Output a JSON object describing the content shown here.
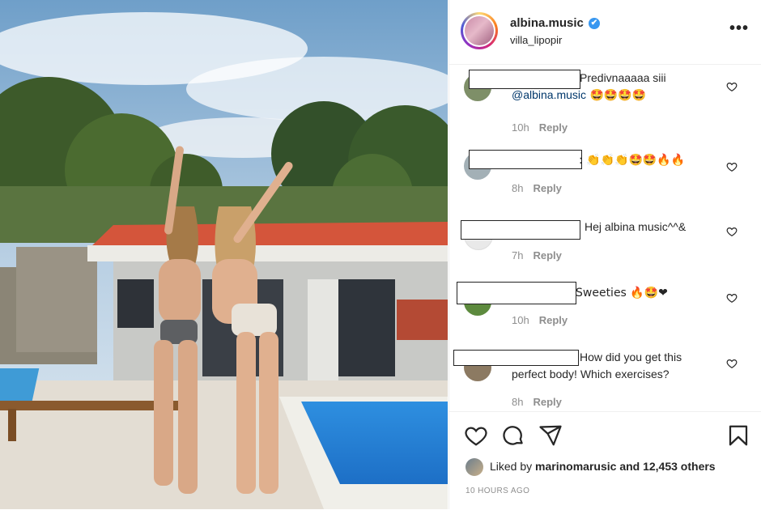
{
  "post": {
    "username": "albina.music",
    "verified_mark": "✔",
    "location": "villa_lipopir",
    "more_label": "•••",
    "likes_prefix": "Liked by",
    "likes_user": "marinomarusic",
    "likes_suffix": "and 12,453 others",
    "timestamp": "10 HOURS AGO"
  },
  "comments": [
    {
      "text_pre": "Predivnaaaaa siii ",
      "mention": "@albina.music",
      "text_post": " 🤩🤩🤩🤩",
      "age": "10h",
      "reply": "Reply"
    },
    {
      "text_pre": ": 👏👏👏🤩🤩🔥🔥",
      "mention": "",
      "text_post": "",
      "age": "8h",
      "reply": "Reply"
    },
    {
      "text_pre": "Hej albina music^^&",
      "mention": "",
      "text_post": "",
      "age": "7h",
      "reply": "Reply"
    },
    {
      "text_pre": "Sweeties 🔥🤩❤",
      "mention": "",
      "text_post": "",
      "age": "10h",
      "reply": "Reply"
    },
    {
      "text_pre": "How did you get this perfect body! Which exercises?",
      "mention": "",
      "text_post": "",
      "age": "8h",
      "reply": "Reply"
    }
  ],
  "icons": {
    "like": "heart-icon",
    "comment": "comment-icon",
    "share": "share-icon",
    "save": "bookmark-icon"
  },
  "colors": {
    "link": "#00376b",
    "muted": "#8e8e8e",
    "verified": "#3897f0"
  }
}
